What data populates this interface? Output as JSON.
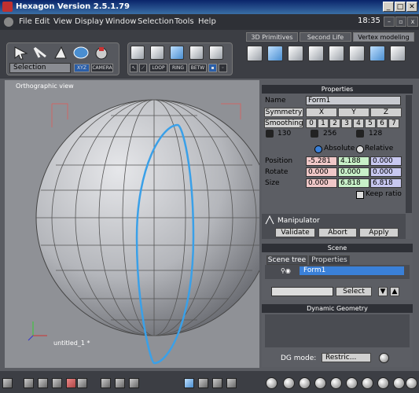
{
  "window": {
    "title": "Hexagon Version 2.5.1.79",
    "minimize": "_",
    "maximize": "□",
    "close": "✕"
  },
  "menu": {
    "items": [
      "File",
      "Edit",
      "View",
      "Display",
      "Window",
      "Selection",
      "Tools",
      "Help"
    ],
    "time": "18:35"
  },
  "tabs": [
    "3D Primitives",
    "Second Life",
    "Vertex modeling"
  ],
  "toolbar": {
    "selection_mode": "Selection",
    "xyz": "XYZ",
    "camera": "CAMERA",
    "loop": "LOOP",
    "ring": "RING",
    "betw": "BETW"
  },
  "viewport": {
    "label": "Orthographic view",
    "object_label": "untitled_1 *"
  },
  "properties": {
    "header": "Properties",
    "name_label": "Name",
    "name_value": "Form1",
    "symmetry_label": "Symmetry",
    "sym_axes": [
      "X",
      "Y",
      "Z"
    ],
    "smoothing_label": "Smoothing",
    "smooth_levels": [
      "0",
      "1",
      "2",
      "3",
      "4",
      "5",
      "6",
      "7"
    ],
    "counts": [
      "130",
      "256",
      "128"
    ],
    "absolute_label": "Absolute",
    "relative_label": "Relative",
    "position_label": "Position",
    "position": [
      "-5.281",
      "4.188",
      "0.000"
    ],
    "rotate_label": "Rotate",
    "rotate": [
      "0.000",
      "0.000",
      "0.000"
    ],
    "size_label": "Size",
    "size": [
      "0.000",
      "6.818",
      "6.818"
    ],
    "keep_ratio_label": "Keep ratio",
    "manipulator_label": "Manipulator",
    "validate": "Validate",
    "abort": "Abort",
    "apply": "Apply"
  },
  "scene": {
    "header": "Scene",
    "tab_tree": "Scene tree",
    "tab_props": "Properties",
    "item": "Form1",
    "select_btn": "Select"
  },
  "dynamic_geometry": {
    "header": "Dynamic Geometry",
    "dg_mode_label": "DG mode:",
    "dg_mode_value": "Restric..."
  },
  "colors": {
    "highlight": "#3aa0e8",
    "selection_row": "#3a80d8"
  }
}
